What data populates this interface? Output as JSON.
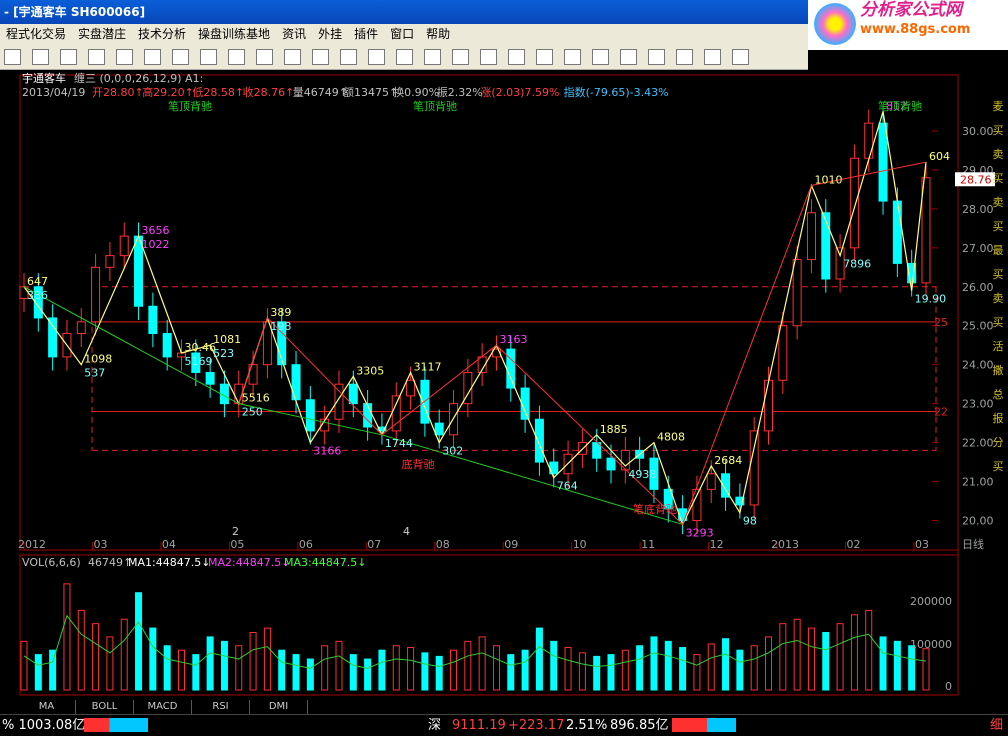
{
  "window": {
    "title": "- [宇通客车  SH600066]",
    "logo_text": "分析家公式网",
    "logo_url": "www.88gs.com"
  },
  "menu": [
    "程式化交易",
    "实盘潜庄",
    "技术分析",
    "操盘训练基地",
    "资讯",
    "外挂",
    "插件",
    "窗口",
    "帮助"
  ],
  "toolbar_icons": [
    "open-icon",
    "calc-icon",
    "search-icon",
    "dashboard-icon",
    "alarm-icon",
    "pen-icon",
    "grid1-icon",
    "grid2-icon",
    "grid3-icon",
    "grid4-icon",
    "grid5-icon",
    "chart-icon",
    "cursor-icon",
    "line-icon",
    "hline-icon",
    "vline-icon",
    "fan-icon",
    "channel-icon",
    "parallel-icon",
    "rect-icon",
    "ellipse-icon",
    "text-icon",
    "copy-icon",
    "erase-icon",
    "lock-icon",
    "magnet-icon",
    "save-icon"
  ],
  "header": {
    "stock": "宇通客车",
    "indicator": "缠三 (0,0,0,26,12,9) A1:",
    "date": "2013/04/19",
    "open": "开28.80↑",
    "high": "高29.20↑",
    "low": "低28.58↑",
    "close": "收28.76↑",
    "vol": "量46749↑",
    "amt": "额13475↑",
    "turnover": "换0.90%",
    "amp": "振2.32%",
    "chg": "涨(2.03)7.59%",
    "index": "指数(-79.65)-3.43%"
  },
  "price_axis": [
    "30.00",
    "29.00",
    "28.00",
    "27.00",
    "26.00",
    "25.00",
    "24.00",
    "23.00",
    "22.00",
    "21.00",
    "20.00"
  ],
  "current_price": "28.76",
  "x_axis": [
    "2012",
    "03",
    "04",
    "05",
    "06",
    "07",
    "08",
    "09",
    "10",
    "11",
    "12",
    "2013",
    "02",
    "03"
  ],
  "axis_unit": "日线",
  "annotations": [
    {
      "text": "笔顶背驰",
      "color": "#22cc22"
    },
    {
      "text": "笔顶背驰",
      "color": "#22cc22"
    },
    {
      "text": "笔顶背驰",
      "color": "#22cc22"
    },
    {
      "text": "底背驰",
      "color": "#ff3030"
    },
    {
      "text": "笔底背驰",
      "color": "#ff3030"
    }
  ],
  "point_labels": [
    "647",
    "537",
    "3656",
    "5169",
    "1081",
    "250",
    "389",
    "3166",
    "3305",
    "1744",
    "3117",
    "302",
    "3163",
    "764",
    "1885",
    "4938",
    "4808",
    "3293",
    "2684",
    "98",
    "1010",
    "7896",
    "812",
    "19.90",
    "604",
    "386",
    "1098",
    "1022",
    "30.46",
    "523",
    "5516",
    "198"
  ],
  "misc_labels": [
    "2",
    "4"
  ],
  "level_labels": [
    "25",
    "22"
  ],
  "right_strip": "麦买卖买卖买最买卖买活撒总报分买",
  "volume": {
    "title": "VOL(6,6,6)",
    "vol": "46749↑",
    "ma1": "MA1:44847.5↓",
    "ma2": "MA2:44847.5↓",
    "ma3": "MA3:44847.5↓",
    "axis": [
      "200000",
      "100000",
      "0"
    ]
  },
  "tabs": [
    "MA",
    "BOLL",
    "MACD",
    "RSI",
    "DMI"
  ],
  "status": {
    "left": "% 1003.08亿",
    "market": "深",
    "index": "9111.19",
    "chg": "+223.17",
    "pct": "2.51%",
    "amt": "896.85亿",
    "right": "细"
  },
  "colors": {
    "up": "#ff3030",
    "down": "#00ffff",
    "grid": "#8b0000",
    "text_up": "#ff4040",
    "text_down": "#00c0c0"
  },
  "chart_data": {
    "type": "candlestick",
    "x_labels": [
      "2012",
      "03",
      "04",
      "05",
      "06",
      "07",
      "08",
      "09",
      "10",
      "11",
      "12",
      "2013",
      "02",
      "03"
    ],
    "ylim": [
      19.5,
      31
    ],
    "levels": [
      26.0,
      25.1,
      22.8,
      21.8
    ],
    "stroke_zigzag": [
      [
        0,
        26.0
      ],
      [
        4,
        24.0
      ],
      [
        8,
        27.3
      ],
      [
        11,
        24.3
      ],
      [
        13,
        24.5
      ],
      [
        15,
        23.0
      ],
      [
        17,
        25.2
      ],
      [
        20,
        22.0
      ],
      [
        23,
        23.7
      ],
      [
        25,
        22.2
      ],
      [
        27,
        23.8
      ],
      [
        29,
        22.0
      ],
      [
        33,
        24.5
      ],
      [
        37,
        21.1
      ],
      [
        40,
        22.2
      ],
      [
        42,
        21.4
      ],
      [
        44,
        22.0
      ],
      [
        46,
        19.9
      ],
      [
        48,
        21.4
      ],
      [
        50,
        20.2
      ],
      [
        55,
        28.6
      ],
      [
        57,
        26.8
      ],
      [
        60,
        30.5
      ],
      [
        62,
        25.9
      ],
      [
        63,
        29.2
      ]
    ],
    "rising_red": [
      [
        15,
        23.0
      ],
      [
        17,
        25.2
      ],
      [
        25,
        22.2
      ],
      [
        33,
        24.5
      ],
      [
        46,
        19.9
      ],
      [
        55,
        28.6
      ],
      [
        63,
        29.2
      ]
    ],
    "closes": [
      26.0,
      25.2,
      24.2,
      24.8,
      25.1,
      26.5,
      26.8,
      27.3,
      25.5,
      24.8,
      24.2,
      24.3,
      23.8,
      23.5,
      23.0,
      23.5,
      24.0,
      25.1,
      24.0,
      23.1,
      22.3,
      22.6,
      23.5,
      23.0,
      22.4,
      22.3,
      23.2,
      23.6,
      22.5,
      22.2,
      23.0,
      23.8,
      24.2,
      24.4,
      23.4,
      22.6,
      21.5,
      21.2,
      21.7,
      22.0,
      21.6,
      21.3,
      21.8,
      21.6,
      20.8,
      20.3,
      20.0,
      20.8,
      21.2,
      20.6,
      20.4,
      22.3,
      23.6,
      25.0,
      26.7,
      27.9,
      26.2,
      27.0,
      29.3,
      30.2,
      28.2,
      26.6,
      26.1,
      28.8
    ],
    "volumes": [
      55,
      40,
      45,
      120,
      90,
      75,
      60,
      80,
      110,
      70,
      50,
      45,
      40,
      60,
      55,
      50,
      65,
      70,
      45,
      40,
      35,
      50,
      55,
      40,
      35,
      45,
      50,
      48,
      42,
      38,
      45,
      55,
      60,
      50,
      40,
      45,
      70,
      55,
      48,
      42,
      38,
      40,
      45,
      50,
      60,
      55,
      48,
      40,
      52,
      58,
      45,
      50,
      60,
      75,
      80,
      70,
      65,
      75,
      85,
      90,
      60,
      55,
      50,
      46.7
    ]
  }
}
